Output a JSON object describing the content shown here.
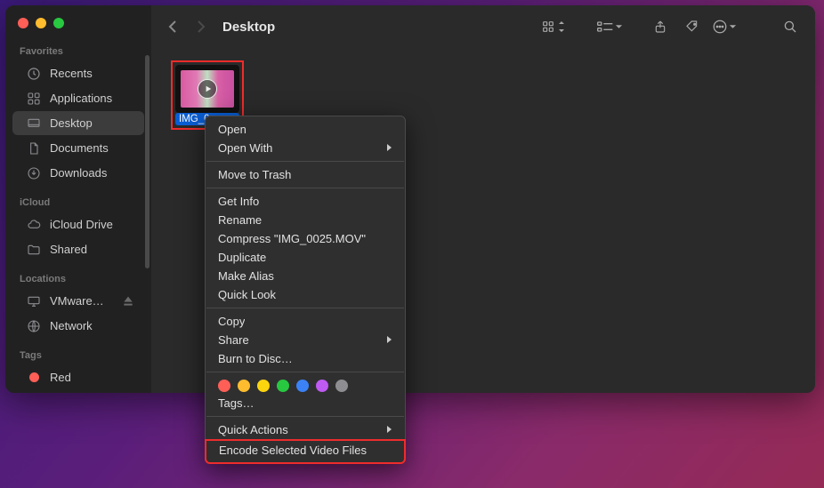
{
  "window": {
    "title": "Desktop"
  },
  "sidebar": {
    "sections": [
      {
        "title": "Favorites",
        "items": [
          {
            "icon": "clock-icon",
            "label": "Recents",
            "active": false
          },
          {
            "icon": "app-grid-icon",
            "label": "Applications",
            "active": false
          },
          {
            "icon": "desktop-icon",
            "label": "Desktop",
            "active": true
          },
          {
            "icon": "document-icon",
            "label": "Documents",
            "active": false
          },
          {
            "icon": "download-icon",
            "label": "Downloads",
            "active": false
          }
        ]
      },
      {
        "title": "iCloud",
        "items": [
          {
            "icon": "cloud-icon",
            "label": "iCloud Drive",
            "active": false
          },
          {
            "icon": "folder-icon",
            "label": "Shared",
            "active": false
          }
        ]
      },
      {
        "title": "Locations",
        "items": [
          {
            "icon": "display-icon",
            "label": "VMware…",
            "active": false,
            "eject": true
          },
          {
            "icon": "globe-icon",
            "label": "Network",
            "active": false
          }
        ]
      },
      {
        "title": "Tags",
        "items": [
          {
            "icon": "tag-red-icon",
            "label": "Red",
            "active": false
          }
        ]
      }
    ]
  },
  "toolbar": {
    "view_mode": "icons",
    "tools": [
      "grid-view",
      "group-by",
      "share",
      "tags",
      "actions",
      "search"
    ]
  },
  "file": {
    "name": "IMG_0025.MOV",
    "display_name": "IMG_0…"
  },
  "context_menu": {
    "groups": [
      [
        {
          "label": "Open"
        },
        {
          "label": "Open With",
          "submenu": true
        }
      ],
      [
        {
          "label": "Move to Trash"
        }
      ],
      [
        {
          "label": "Get Info"
        },
        {
          "label": "Rename"
        },
        {
          "label": "Compress \"IMG_0025.MOV\""
        },
        {
          "label": "Duplicate"
        },
        {
          "label": "Make Alias"
        },
        {
          "label": "Quick Look"
        }
      ],
      [
        {
          "label": "Copy"
        },
        {
          "label": "Share",
          "submenu": true
        },
        {
          "label": "Burn to Disc…"
        }
      ]
    ],
    "tag_colors": [
      "#ff5f57",
      "#febc2e",
      "#fdd50f",
      "#28c840",
      "#3b82f6",
      "#bf5af2",
      "#8e8e92"
    ],
    "tags_label": "Tags…",
    "quick_actions": {
      "label": "Quick Actions",
      "submenu": true
    },
    "encode": {
      "label": "Encode Selected Video Files"
    }
  }
}
